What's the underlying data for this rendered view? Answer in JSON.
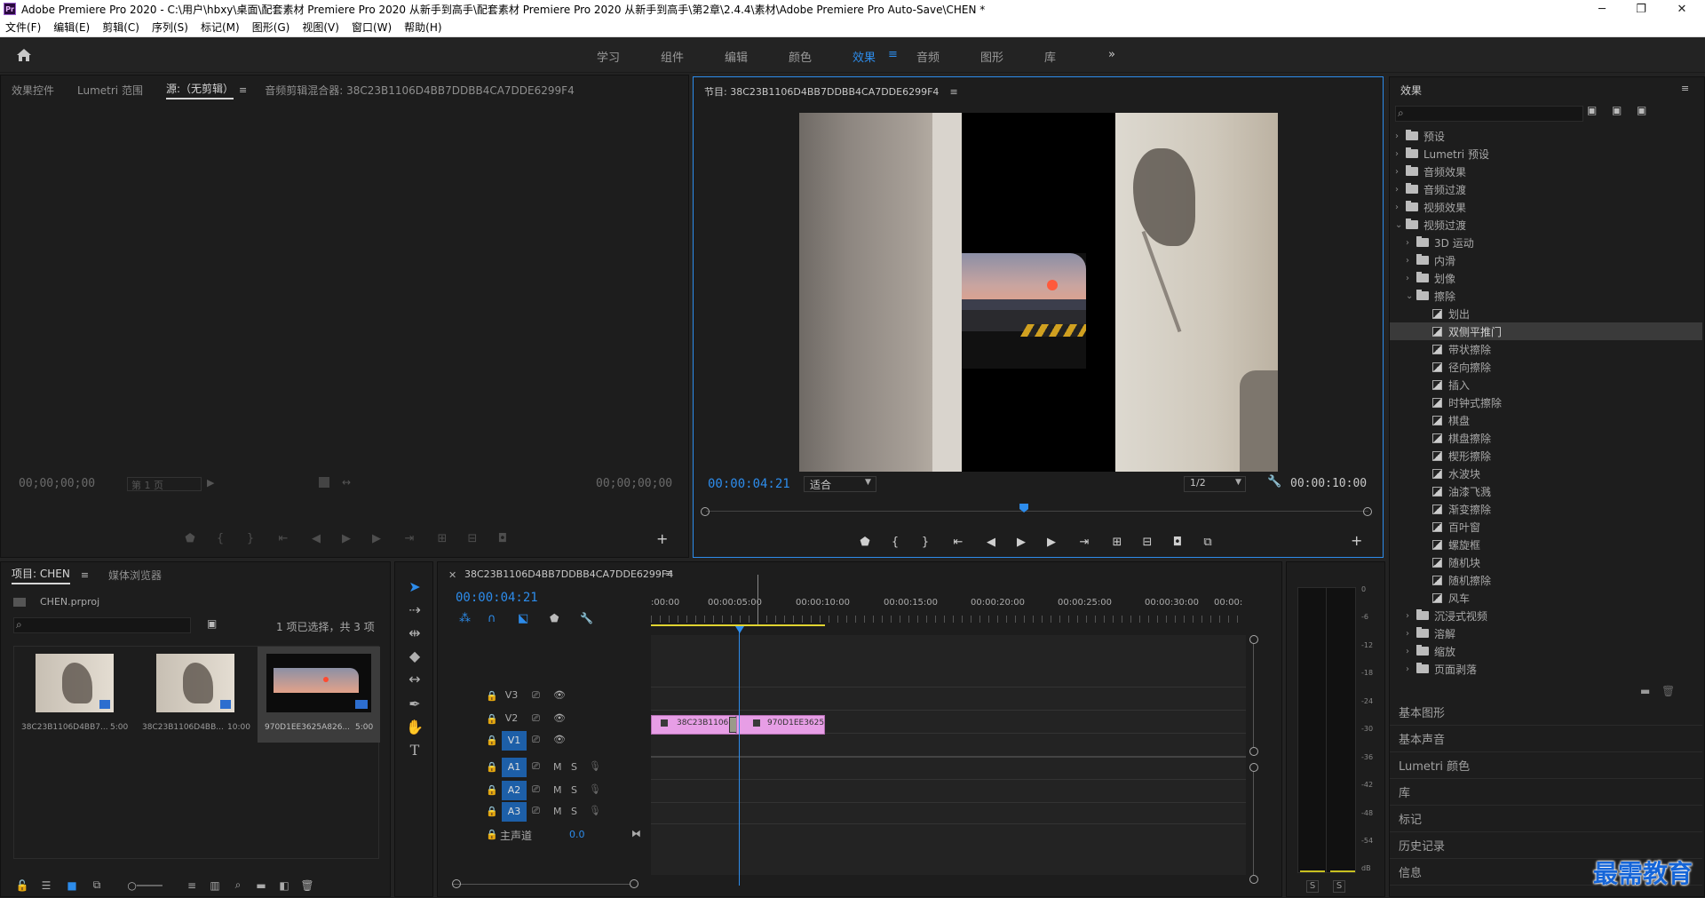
{
  "window": {
    "title": "Adobe Premiere Pro 2020 - C:\\用户\\hbxy\\桌面\\配套素材 Premiere Pro 2020 从新手到高手\\配套素材 Premiere Pro 2020 从新手到高手\\第2章\\2.4.4\\素材\\Adobe Premiere Pro Auto-Save\\CHEN *",
    "logo": "Pr",
    "minimize": "─",
    "maximize": "❐",
    "close": "✕"
  },
  "menu": [
    "文件(F)",
    "编辑(E)",
    "剪辑(C)",
    "序列(S)",
    "标记(M)",
    "图形(G)",
    "视图(V)",
    "窗口(W)",
    "帮助(H)"
  ],
  "workspaces": [
    "学习",
    "组件",
    "编辑",
    "颜色",
    "效果",
    "音频",
    "图形",
    "库"
  ],
  "workspace_active_index": 4,
  "workspace_more": "»",
  "source_panel": {
    "tabs": [
      "效果控件",
      "Lumetri 范围",
      "源:（无剪辑）",
      "音频剪辑混合器: 38C23B1106D4BB7DDBB4CA7DDE6299F4"
    ],
    "active_tab": 2,
    "tc_left": "00;00;00;00",
    "page": "第 1 页",
    "tc_right": "00;00;00;00"
  },
  "program_panel": {
    "title": "节目: 38C23B1106D4BB7DDBB4CA7DDE6299F4",
    "tc_current": "00:00:04:21",
    "fit": "适合",
    "resolution": "1/2",
    "tc_duration": "00:00:10:00",
    "playhead_fraction": 0.48
  },
  "effects_panel": {
    "title": "效果",
    "tree": [
      {
        "label": "预设",
        "level": 0,
        "type": "folder",
        "open": false
      },
      {
        "label": "Lumetri 预设",
        "level": 0,
        "type": "folder",
        "open": false
      },
      {
        "label": "音频效果",
        "level": 0,
        "type": "folder",
        "open": false
      },
      {
        "label": "音频过渡",
        "level": 0,
        "type": "folder",
        "open": false
      },
      {
        "label": "视频效果",
        "level": 0,
        "type": "folder",
        "open": false
      },
      {
        "label": "视频过渡",
        "level": 0,
        "type": "folder",
        "open": true
      },
      {
        "label": "3D 运动",
        "level": 1,
        "type": "folder",
        "open": false
      },
      {
        "label": "内滑",
        "level": 1,
        "type": "folder",
        "open": false
      },
      {
        "label": "划像",
        "level": 1,
        "type": "folder",
        "open": false
      },
      {
        "label": "擦除",
        "level": 1,
        "type": "folder",
        "open": true
      },
      {
        "label": "划出",
        "level": 2,
        "type": "fx"
      },
      {
        "label": "双侧平推门",
        "level": 2,
        "type": "fx",
        "selected": true
      },
      {
        "label": "带状擦除",
        "level": 2,
        "type": "fx"
      },
      {
        "label": "径向擦除",
        "level": 2,
        "type": "fx"
      },
      {
        "label": "插入",
        "level": 2,
        "type": "fx"
      },
      {
        "label": "时钟式擦除",
        "level": 2,
        "type": "fx"
      },
      {
        "label": "棋盘",
        "level": 2,
        "type": "fx"
      },
      {
        "label": "棋盘擦除",
        "level": 2,
        "type": "fx"
      },
      {
        "label": "楔形擦除",
        "level": 2,
        "type": "fx"
      },
      {
        "label": "水波块",
        "level": 2,
        "type": "fx"
      },
      {
        "label": "油漆飞溅",
        "level": 2,
        "type": "fx"
      },
      {
        "label": "渐变擦除",
        "level": 2,
        "type": "fx"
      },
      {
        "label": "百叶窗",
        "level": 2,
        "type": "fx"
      },
      {
        "label": "螺旋框",
        "level": 2,
        "type": "fx"
      },
      {
        "label": "随机块",
        "level": 2,
        "type": "fx"
      },
      {
        "label": "随机擦除",
        "level": 2,
        "type": "fx"
      },
      {
        "label": "风车",
        "level": 2,
        "type": "fx"
      },
      {
        "label": "沉浸式视频",
        "level": 1,
        "type": "folder",
        "open": false
      },
      {
        "label": "溶解",
        "level": 1,
        "type": "folder",
        "open": false
      },
      {
        "label": "缩放",
        "level": 1,
        "type": "folder",
        "open": false
      },
      {
        "label": "页面剥落",
        "level": 1,
        "type": "folder",
        "open": false
      }
    ],
    "side_panels": [
      "基本图形",
      "基本声音",
      "Lumetri 颜色",
      "库",
      "标记",
      "历史记录",
      "信息"
    ]
  },
  "project_panel": {
    "tabs": [
      "项目: CHEN",
      "媒体浏览器"
    ],
    "file": "CHEN.prproj",
    "selection": "1 项已选择，共 3 项",
    "items": [
      {
        "name": "38C23B1106D4BB7...",
        "dur": "5:00"
      },
      {
        "name": "38C23B1106D4BB...",
        "dur": "10:00"
      },
      {
        "name": "970D1EE3625A826...",
        "dur": "5:00"
      }
    ]
  },
  "timeline": {
    "title": "38C23B1106D4BB7DDBB4CA7DDE6299F4",
    "tc": "00:00:04:21",
    "ruler": [
      ":00:00",
      "00:00:05:00",
      "00:00:10:00",
      "00:00:15:00",
      "00:00:20:00",
      "00:00:25:00",
      "00:00:30:00",
      "00:00:"
    ],
    "video_tracks": [
      "V3",
      "V2",
      "V1"
    ],
    "audio_tracks": [
      "A1",
      "A2",
      "A3"
    ],
    "master_label": "主声道",
    "master_value": "0.0",
    "clip1": "38C23B1106",
    "clip2": "970D1EE3625",
    "mute": "M",
    "solo": "S"
  },
  "meter": {
    "scale": [
      "0",
      "-6",
      "-12",
      "-18",
      "-24",
      "-30",
      "-36",
      "-42",
      "-48",
      "-54",
      "dB"
    ],
    "solo": "S"
  },
  "watermark": "最需教育"
}
